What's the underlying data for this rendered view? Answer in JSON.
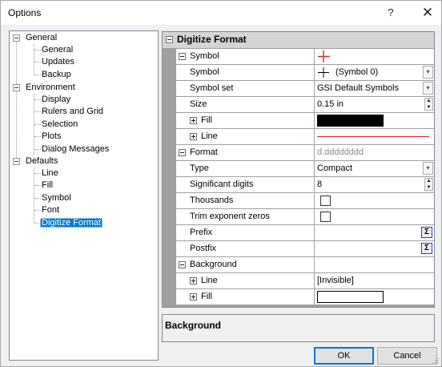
{
  "window": {
    "title": "Options",
    "help_glyph": "?",
    "close_glyph": "✕"
  },
  "tree": {
    "groups": [
      {
        "label": "General",
        "children": [
          "General",
          "Updates",
          "Backup"
        ]
      },
      {
        "label": "Environment",
        "children": [
          "Display",
          "Rulers and Grid",
          "Selection",
          "Plots",
          "Dialog Messages"
        ]
      },
      {
        "label": "Defaults",
        "children": [
          "Line",
          "Fill",
          "Symbol",
          "Font",
          "Digitize Format"
        ]
      }
    ],
    "selected": "Digitize Format"
  },
  "grid": {
    "header": "Digitize Format",
    "symbol_section": "Symbol",
    "symbol_label": "Symbol",
    "symbol_value": "(Symbol 0)",
    "symbol_set_label": "Symbol set",
    "symbol_set_value": "GSI Default Symbols",
    "size_label": "Size",
    "size_value": "0.15 in",
    "fill_label": "Fill",
    "line_label": "Line",
    "format_section": "Format",
    "format_preview": "d.dddddddd",
    "type_label": "Type",
    "type_value": "Compact",
    "sig_label": "Significant digits",
    "sig_value": "8",
    "thousands_label": "Thousands",
    "trim_label": "Trim exponent zeros",
    "prefix_label": "Prefix",
    "postfix_label": "Postfix",
    "sigma_glyph": "Σ",
    "background_section": "Background",
    "bg_line_label": "Line",
    "bg_line_value": "[Invisible]",
    "bg_fill_label": "Fill"
  },
  "colors": {
    "symbol_color": "#e0202a",
    "fill_swatch": "#000000",
    "bg_fill_swatch": "#ffffff"
  },
  "description": {
    "title": "Background"
  },
  "buttons": {
    "ok": "OK",
    "cancel": "Cancel"
  }
}
